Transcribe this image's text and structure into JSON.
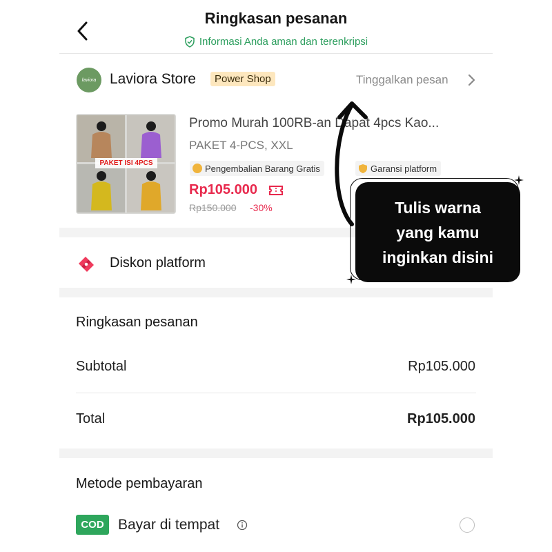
{
  "header": {
    "title": "Ringkasan pesanan",
    "secure_text": "Informasi Anda aman dan terenkripsi",
    "back_icon": "chevron-left-icon",
    "secure_icon": "shield-check-icon"
  },
  "store": {
    "avatar_text": "laviora",
    "name": "Laviora Store",
    "badge": "Power Shop",
    "message_link": "Tinggalkan pesan",
    "chevron_icon": "chevron-right-icon"
  },
  "product": {
    "name": "Promo Murah 100RB-an Dapat 4pcs Kao...",
    "variant": "PAKET 4-PCS, XXL",
    "thumb_banner": "PAKET ISI 4PCS",
    "tags": [
      "Pengembalian Barang Gratis",
      "Garansi platform"
    ],
    "price": "Rp105.000",
    "old_price": "Rp150.000",
    "discount": "-30%"
  },
  "discount_row": {
    "label": "Diskon platform",
    "icon": "discount-tag-icon"
  },
  "summary": {
    "title": "Ringkasan pesanan",
    "rows": [
      {
        "label": "Subtotal",
        "value": "Rp105.000"
      },
      {
        "label": "Total",
        "value": "Rp105.000"
      }
    ]
  },
  "payment": {
    "title": "Metode pembayaran",
    "cod_badge": "COD",
    "cod_label": "Bayar di tempat",
    "info_icon": "info-icon"
  },
  "callout": {
    "lines": [
      "Tulis warna",
      "yang kamu",
      "inginkan disini"
    ]
  },
  "colors": {
    "accent_red": "#e8294d",
    "secure_green": "#2a9d5c",
    "cod_green": "#2ea65c",
    "badge_bg": "#fde7be"
  }
}
